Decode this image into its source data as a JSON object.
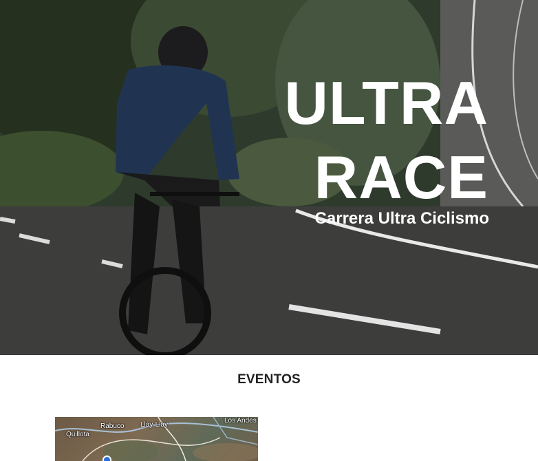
{
  "hero": {
    "title_line1": "ULTRA",
    "title_line2": "RACE",
    "subtitle": "Carrera Ultra Ciclismo"
  },
  "events": {
    "heading": "EVENTOS"
  },
  "map": {
    "labels": {
      "quillota": "Quillota",
      "rabuco": "Rabuco",
      "llay_llay": "Llay-Llay",
      "los_andes": "Los Andes"
    },
    "pin_icon": "map-pin-icon"
  }
}
